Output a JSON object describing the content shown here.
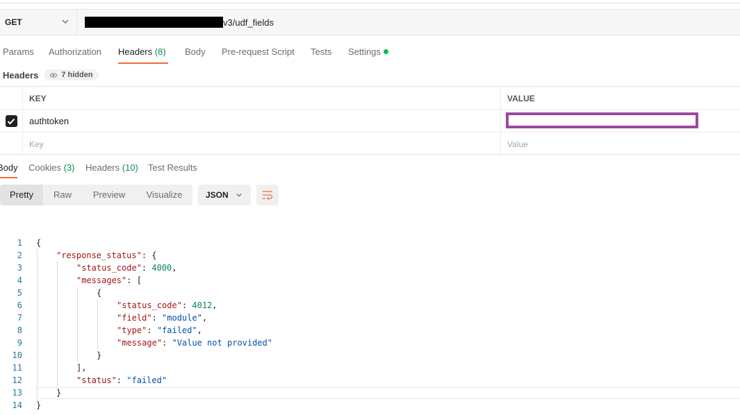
{
  "request": {
    "method": "GET",
    "url_suffix": "v3/udf_fields"
  },
  "request_tabs": [
    {
      "label": "Params"
    },
    {
      "label": "Authorization"
    },
    {
      "label": "Headers",
      "count": "(8)"
    },
    {
      "label": "Body"
    },
    {
      "label": "Pre-request Script"
    },
    {
      "label": "Tests"
    },
    {
      "label": "Settings"
    }
  ],
  "headers_section": {
    "label": "Headers",
    "hidden": "7 hidden",
    "columns": {
      "key": "KEY",
      "value": "VALUE"
    },
    "rows": [
      {
        "key": "authtoken",
        "checked": true
      }
    ],
    "placeholders": {
      "key": "Key",
      "value": "Value"
    }
  },
  "response_tabs": [
    {
      "label": "Body"
    },
    {
      "label": "Cookies",
      "count": "(3)"
    },
    {
      "label": "Headers",
      "count": "(10)"
    },
    {
      "label": "Test Results"
    }
  ],
  "view_modes": [
    "Pretty",
    "Raw",
    "Preview",
    "Visualize"
  ],
  "format": "JSON",
  "code_lines": [
    "{",
    "\"response_status\": {",
    "\"status_code\": 4000,",
    "\"messages\": [",
    "{",
    "\"status_code\": 4012,",
    "\"field\": \"module\",",
    "\"type\": \"failed\",",
    "\"message\": \"Value not provided\"",
    "}",
    "],",
    "\"status\": \"failed\"",
    "}",
    "}"
  ],
  "line_numbers": [
    "1",
    "2",
    "3",
    "4",
    "5",
    "6",
    "7",
    "8",
    "9",
    "10",
    "11",
    "12",
    "13",
    "14"
  ],
  "colors": {
    "accent": "#f26b3a",
    "count": "#0f8a4b",
    "status_dot": "#0cbb52",
    "redact_value": "#9b4a9e"
  }
}
